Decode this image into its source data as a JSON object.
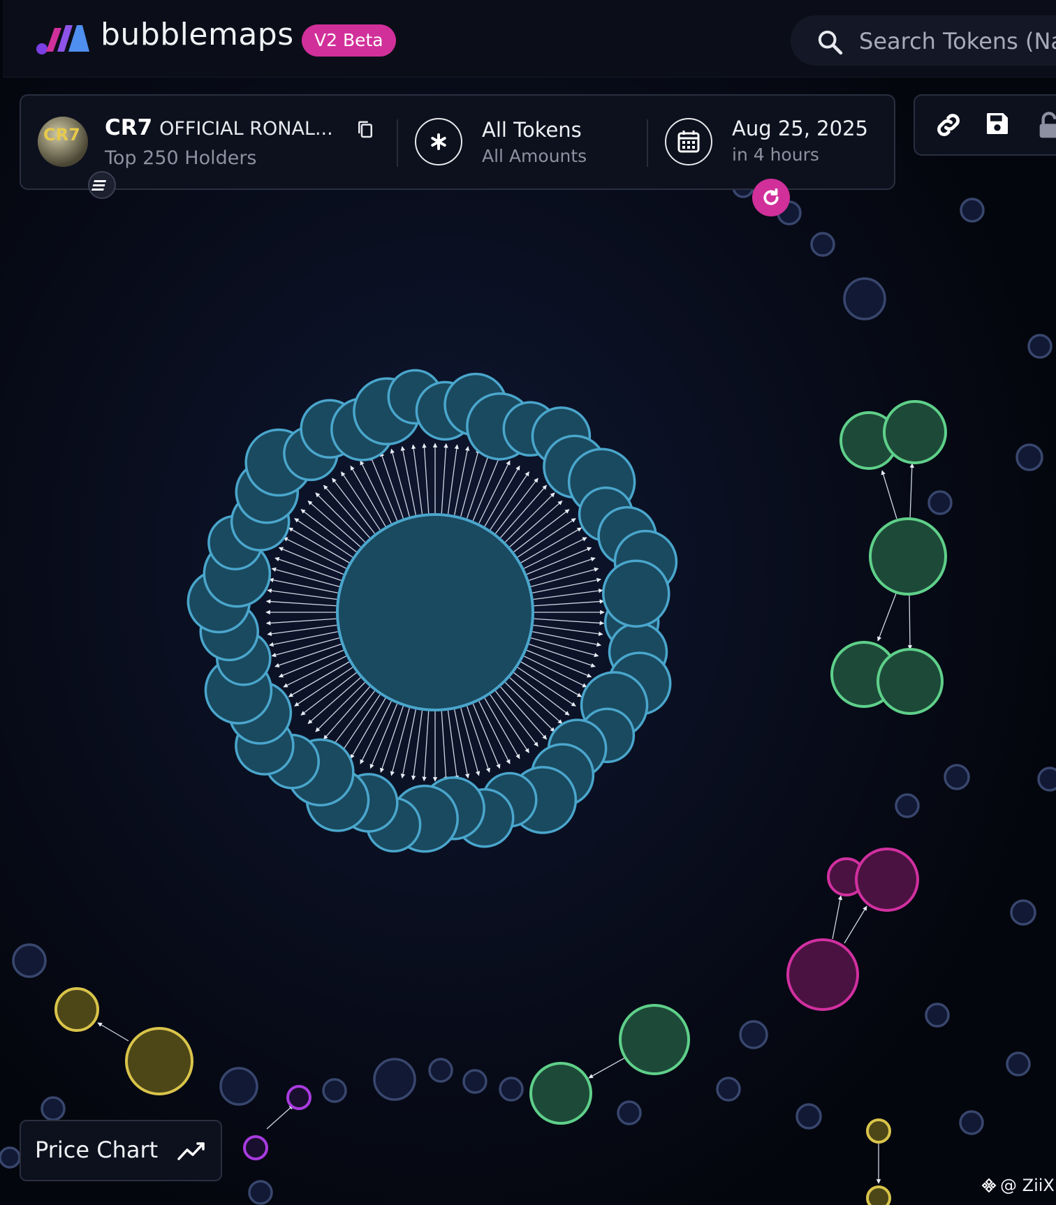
{
  "app": {
    "brand": "bubblemaps",
    "badge": "V2 Beta"
  },
  "search": {
    "placeholder": "Search Tokens (Na"
  },
  "token": {
    "symbol": "CR7",
    "name": "OFFICIAL RONAL...",
    "holders_label": "Top 250 Holders",
    "avatar_text": "CR7"
  },
  "filter": {
    "title": "All Tokens",
    "subtitle": "All Amounts"
  },
  "date": {
    "title": "Aug 25, 2025",
    "subtitle": "in 4 hours"
  },
  "actions": {
    "items": [
      "link-icon",
      "save-icon",
      "lock-icon"
    ]
  },
  "price_chart": {
    "label": "Price Chart"
  },
  "credit": {
    "text": "@ ZiiX"
  },
  "colors": {
    "background": "#05070f",
    "accent": "#d1309a",
    "cluster_blue": "#4aa6cc",
    "cluster_green": "#5fd08a",
    "cluster_pink": "#d130a0",
    "cluster_yellow": "#d9c44a",
    "cluster_purple": "#a93be0",
    "small_bubble": "#39476e"
  },
  "bubble_map": {
    "main_cluster": {
      "color": "blue",
      "ring_count": 44
    },
    "clusters": [
      {
        "color": "green",
        "bubble_count": 5
      },
      {
        "color": "pink",
        "bubble_count": 3
      },
      {
        "color": "yellow",
        "bubble_count": 2
      },
      {
        "color": "green",
        "bubble_count": 2
      },
      {
        "color": "purple",
        "bubble_count": 2
      },
      {
        "color": "yellow",
        "bubble_count": 2
      }
    ]
  }
}
